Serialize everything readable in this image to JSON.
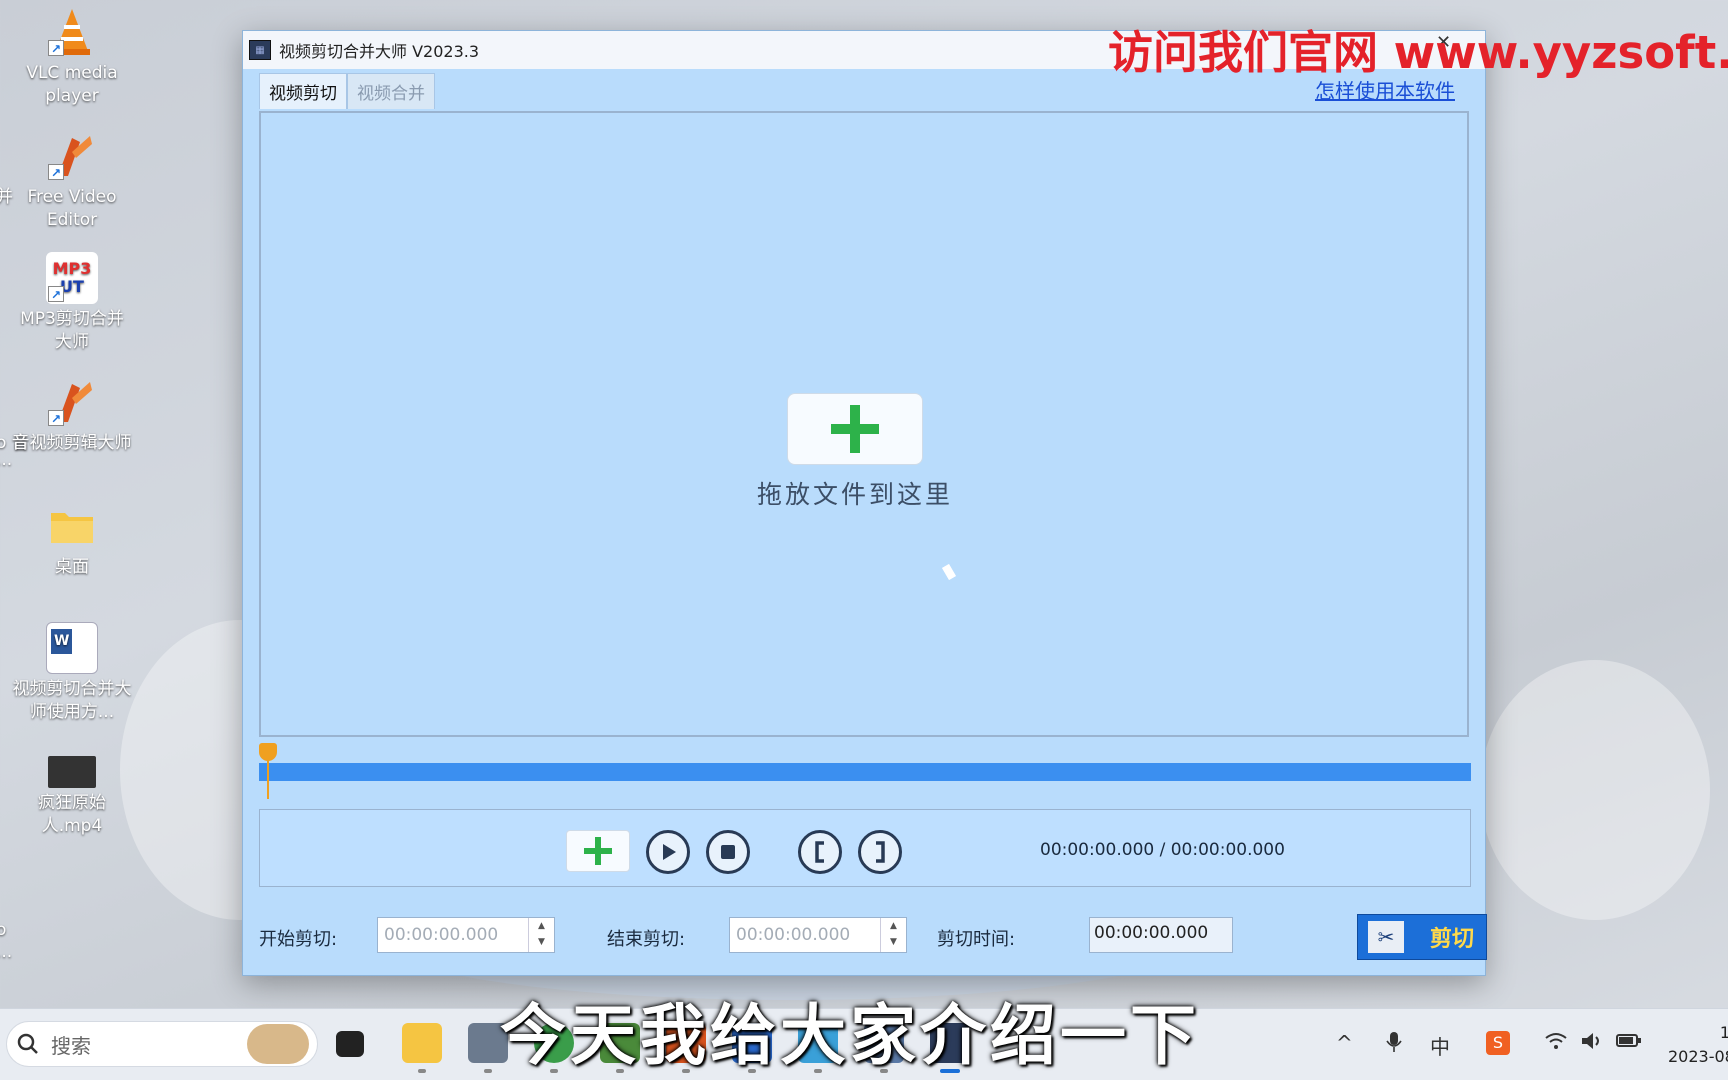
{
  "desktop": {
    "icons": [
      {
        "label": "VLC media player",
        "glyph": "vlc-cone-icon",
        "color": "#f08a1a"
      },
      {
        "label": "Free Video Editor",
        "glyph": "video-editor-icon",
        "color": "#d9531e"
      },
      {
        "label": "MP3剪切合并大师",
        "glyph": "mp3-cut-icon",
        "color": "#e03030"
      },
      {
        "label": "音视频剪辑大师",
        "glyph": "av-editor-icon",
        "color": "#d9531e"
      },
      {
        "label": "桌面",
        "glyph": "folder-icon",
        "color": "#f5c542"
      },
      {
        "label": "视频剪切合并大师使用方...",
        "glyph": "word-doc-icon",
        "color": "#2b579a"
      },
      {
        "label": "疯狂原始人.mp4",
        "glyph": "video-file-icon",
        "color": "#333333"
      }
    ],
    "partial_labels": [
      "并",
      "o 音",
      "...",
      "o",
      "..."
    ]
  },
  "window": {
    "title": "视频剪切合并大师 V2023.3",
    "tabs": [
      {
        "label": "视频剪切",
        "active": true
      },
      {
        "label": "视频合并",
        "active": false
      }
    ],
    "help_link": "怎样使用本软件",
    "drop_text": "拖放文件到这里",
    "time_readout": "00:00:00.000 / 00:00:00.000",
    "start_label": "开始剪切:",
    "start_value": "00:00:00.000",
    "end_label": "结束剪切:",
    "end_value": "00:00:00.000",
    "duration_label": "剪切时间:",
    "duration_value": "00:00:00.000",
    "cut_button": "剪切"
  },
  "watermark": "访问我们官网 www.yyzsoft.co",
  "subtitle": "今天我给大家介绍一下",
  "taskbar": {
    "search_placeholder": "搜索",
    "ime_label": "中",
    "clock_time": "1",
    "clock_date": "2023-08"
  },
  "colors": {
    "window_bg": "#b9dcfc",
    "timeline": "#3b8ff0",
    "accent_green": "#2db24a",
    "watermark_red": "#e4222a",
    "cut_button": "#1c6fd8"
  }
}
